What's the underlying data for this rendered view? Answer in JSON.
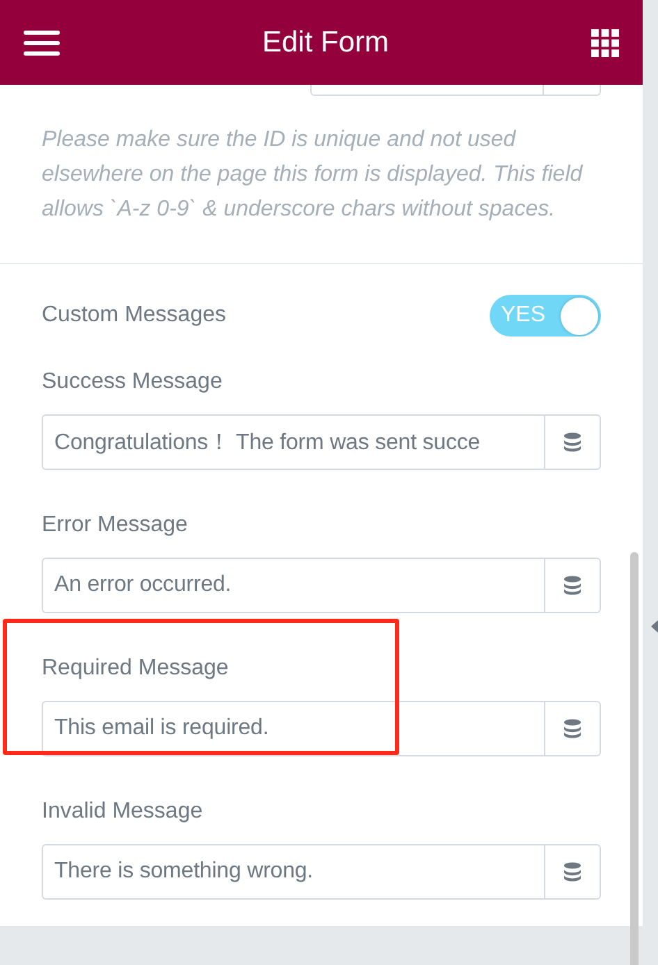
{
  "header": {
    "title": "Edit Form"
  },
  "help_text": "Please make sure the ID is unique and not used elsewhere on the page this form is displayed. This field allows `A-z 0-9` & underscore chars without spaces.",
  "custom_messages": {
    "label": "Custom Messages",
    "on": true,
    "toggle_text": "YES"
  },
  "messages": [
    {
      "label": "Success Message",
      "value": "Congratulations！ The form was sent succe",
      "highlighted": false
    },
    {
      "label": "Error Message",
      "value": "An error occurred.",
      "highlighted": false
    },
    {
      "label": "Required Message",
      "value": "This email is required.",
      "highlighted": true
    },
    {
      "label": "Invalid Message",
      "value": "There is something wrong.",
      "highlighted": false
    }
  ]
}
